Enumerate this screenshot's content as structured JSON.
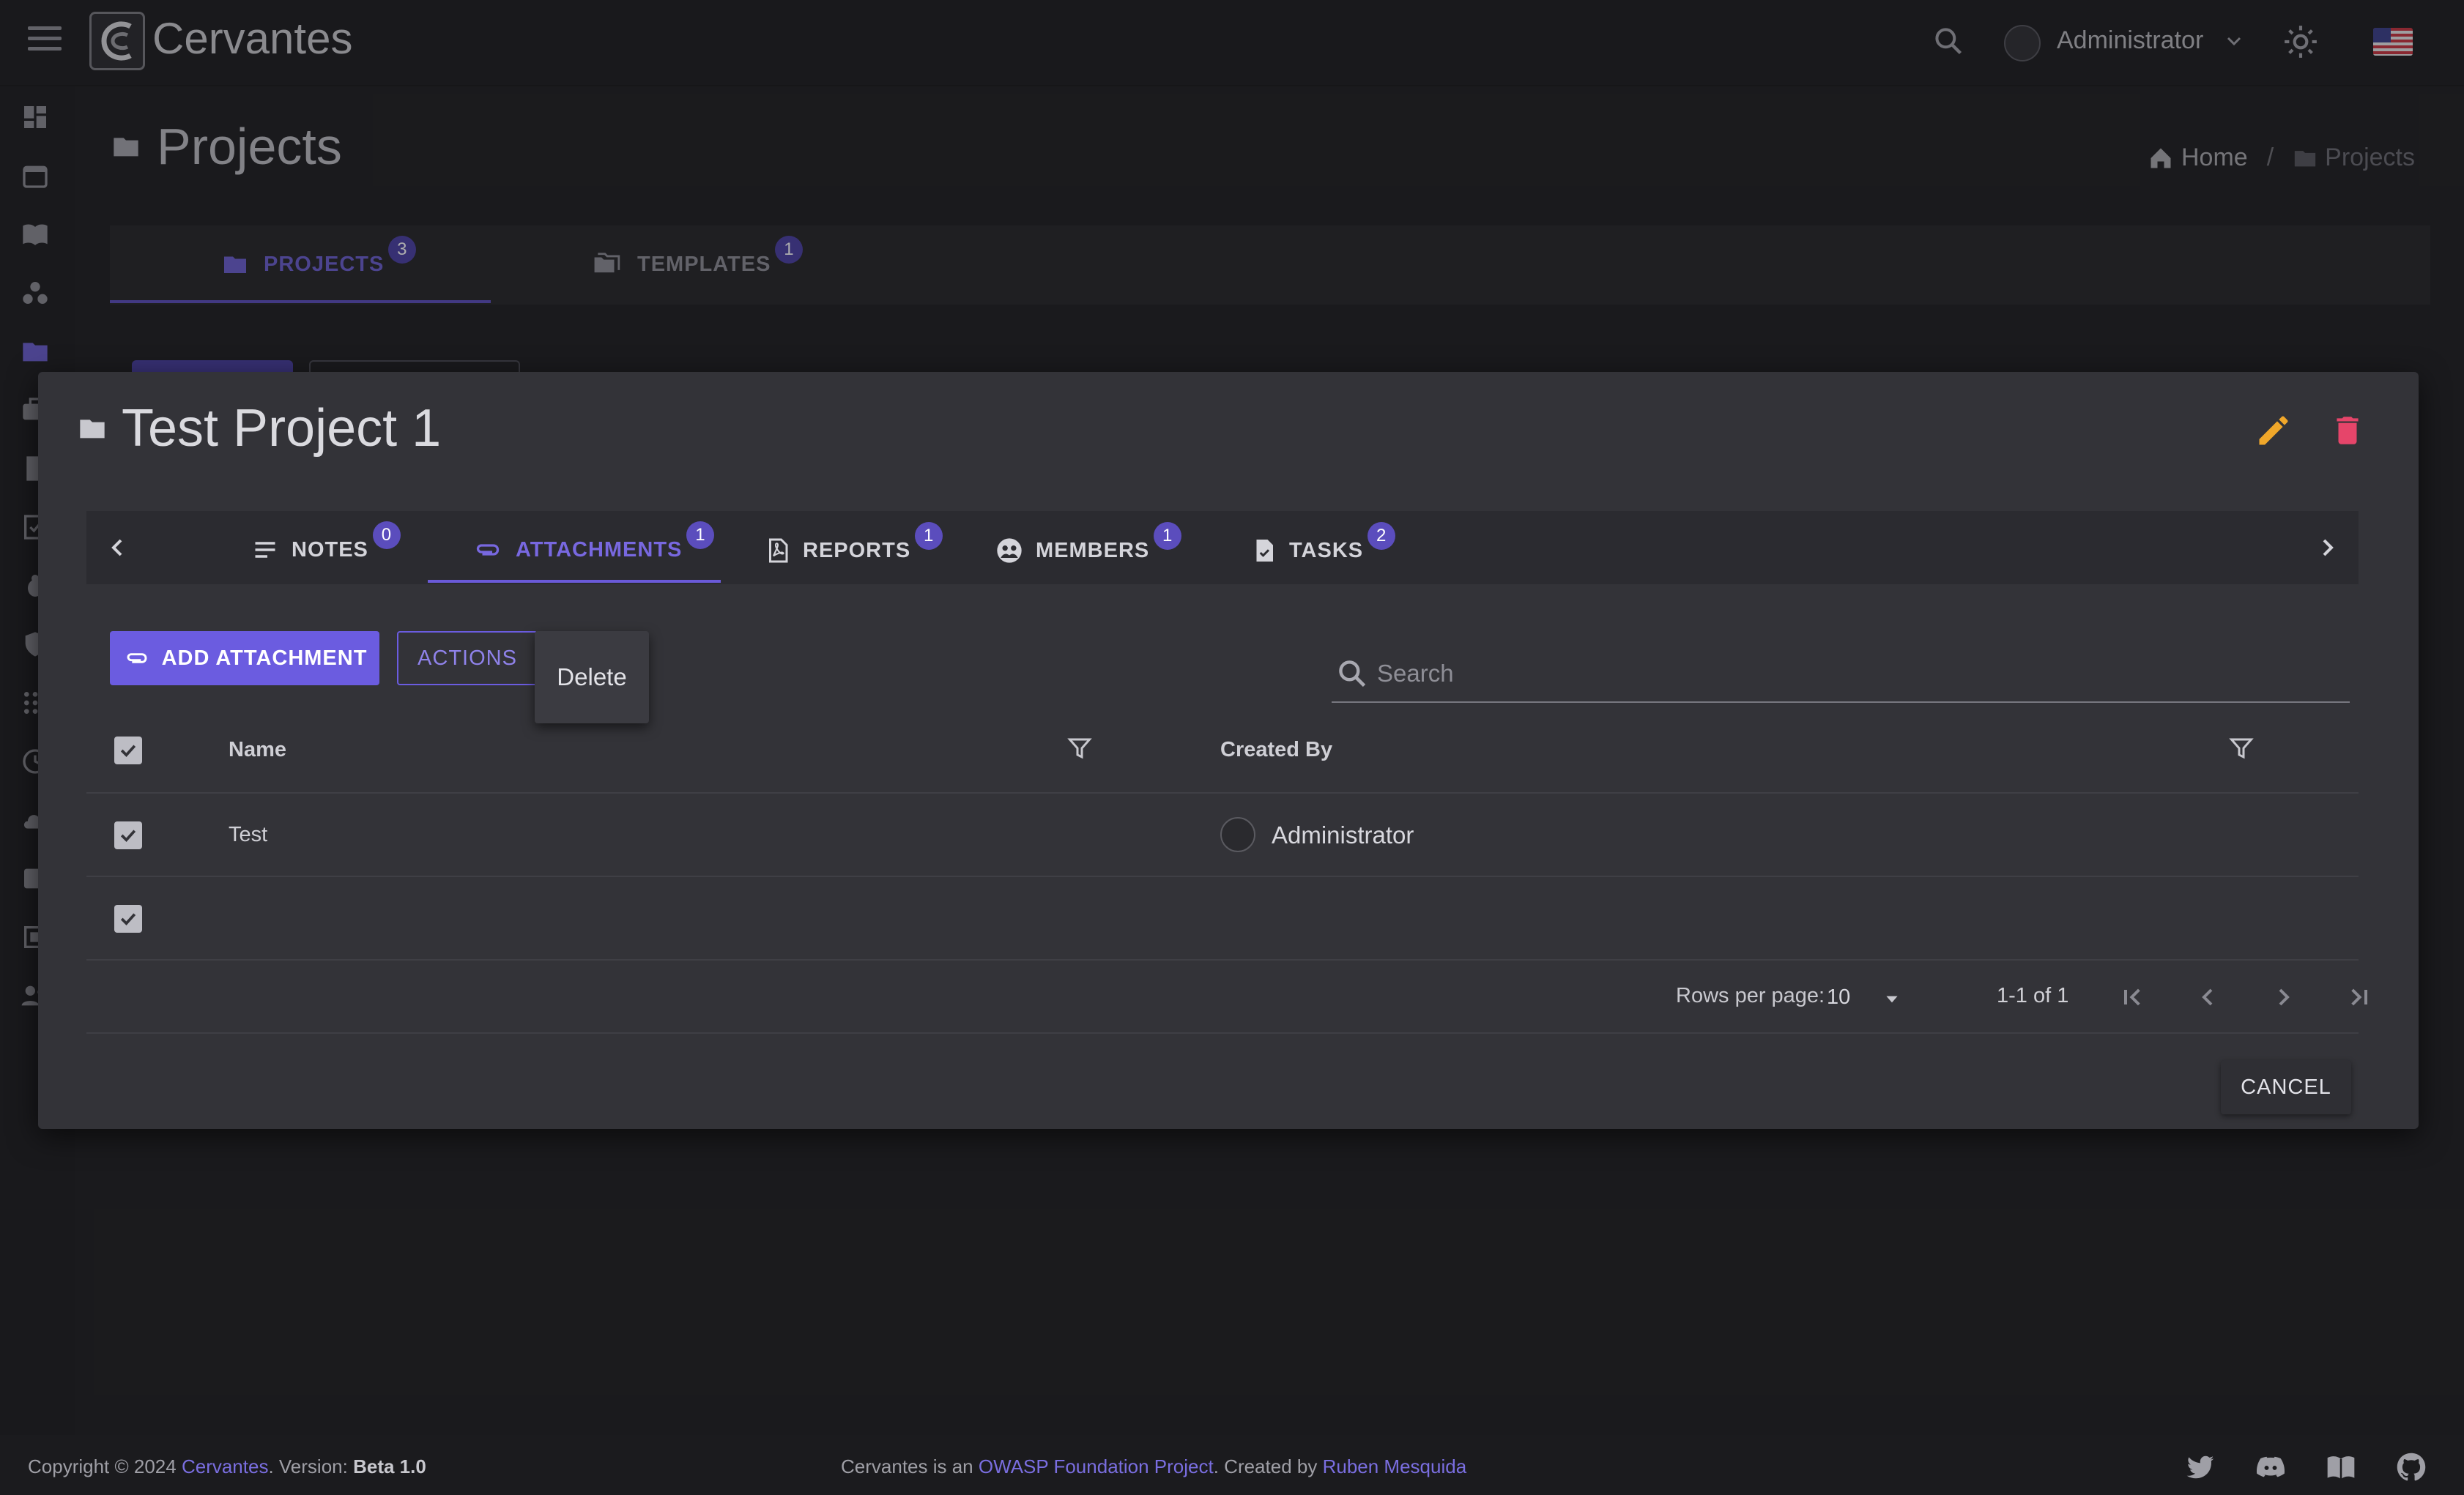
{
  "app": {
    "name": "Cervantes"
  },
  "topbar": {
    "user_name": "Administrator",
    "language": "en-US"
  },
  "rail": {
    "icons": [
      "dashboard-icon",
      "calendar-icon",
      "book-icon",
      "workspaces-icon",
      "folder-icon",
      "briefcase-icon",
      "document-icon",
      "checklist-icon",
      "bug-icon",
      "shield-icon",
      "grid-icon",
      "clock-icon",
      "cloud-upload-icon",
      "contact-icon",
      "report-icon",
      "people-icon"
    ]
  },
  "page": {
    "title": "Projects",
    "breadcrumb": {
      "home": "Home",
      "separator": "/",
      "current": "Projects"
    },
    "tabs": [
      {
        "label": "PROJECTS",
        "count": "3"
      },
      {
        "label": "TEMPLATES",
        "count": "1"
      }
    ]
  },
  "dialog": {
    "title": "Test Project 1",
    "tabs": [
      {
        "label": "NOTES",
        "count": "0"
      },
      {
        "label": "ATTACHMENTS",
        "count": "1"
      },
      {
        "label": "REPORTS",
        "count": "1"
      },
      {
        "label": "MEMBERS",
        "count": "1"
      },
      {
        "label": "TASKS",
        "count": "2"
      }
    ],
    "add_button": "ADD ATTACHMENT",
    "actions_button": "ACTIONS",
    "actions_menu": [
      "Delete"
    ],
    "search": {
      "placeholder": "Search",
      "value": ""
    },
    "table": {
      "columns": [
        "Name",
        "Created By"
      ],
      "rows": [
        {
          "name": "Test",
          "created_by": "Administrator",
          "selected": true
        }
      ]
    },
    "pagination": {
      "rows_per_page_label": "Rows per page:",
      "rows_per_page": "10",
      "range": "1-1 of 1"
    },
    "cancel_button": "CANCEL"
  },
  "footer": {
    "copyright": "Copyright © 2024",
    "app_link": "Cervantes",
    "version_label": ". Version:",
    "version": "Beta 1.0",
    "project_text": "Cervantes is an",
    "owasp_link": "OWASP Foundation Project",
    "created_text": ". Created by",
    "author_link": "Ruben Mesquida"
  },
  "colors": {
    "accent": "#6b5ce0",
    "edit": "#f0a72a",
    "delete": "#e6456a",
    "background": "#1e1e21",
    "dialog": "#333338"
  }
}
